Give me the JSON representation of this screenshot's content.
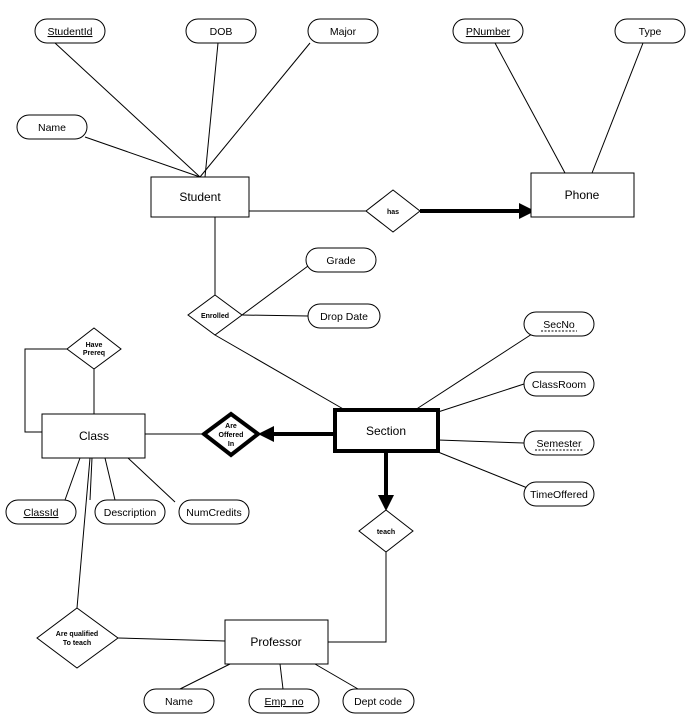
{
  "entities": {
    "student": "Student",
    "phone": "Phone",
    "class": "Class",
    "section": "Section",
    "professor": "Professor"
  },
  "relationships": {
    "has": "has",
    "enrolled": "Enrolled",
    "have_prereq": [
      "Have",
      "Prereq"
    ],
    "are_offered_in": [
      "Are",
      "Offered",
      "In"
    ],
    "teach": "teach",
    "are_qualified": [
      "Are qualified",
      "To teach"
    ]
  },
  "attributes": {
    "student": {
      "student_id": "StudentId",
      "dob": "DOB",
      "major": "Major",
      "name": "Name"
    },
    "phone": {
      "pnumber": "PNumber",
      "type": "Type"
    },
    "enrolled": {
      "grade": "Grade",
      "drop_date": "Drop Date"
    },
    "section": {
      "sec_no": "SecNo",
      "class_room": "ClassRoom",
      "semester": "Semester",
      "time_offered": "TimeOffered"
    },
    "class": {
      "class_id": "ClassId",
      "description": "Description",
      "num_credits": "NumCredits"
    },
    "professor": {
      "name": "Name",
      "emp_no": "Emp_no",
      "dept_code": "Dept code"
    }
  }
}
